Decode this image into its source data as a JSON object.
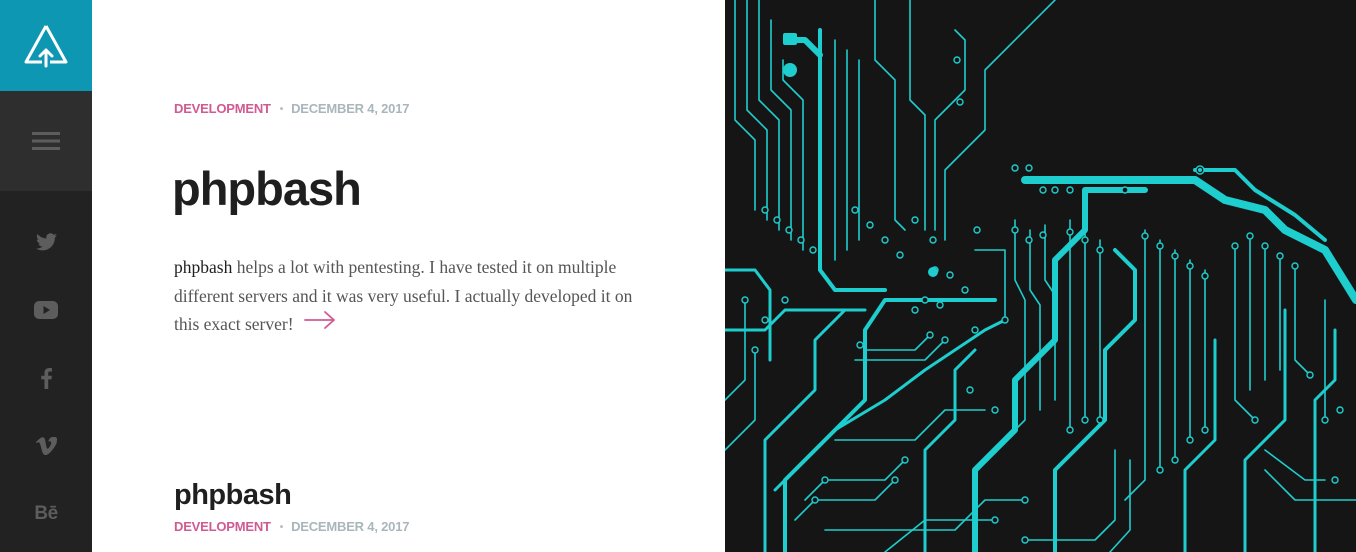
{
  "brand": {
    "logo_icon": "tree-arrow-icon",
    "accent": "#0e97b3"
  },
  "sidebar": {
    "menu_icon": "hamburger-menu-icon",
    "social": [
      {
        "name": "twitter-icon"
      },
      {
        "name": "youtube-icon"
      },
      {
        "name": "facebook-icon"
      },
      {
        "name": "vimeo-icon"
      },
      {
        "name": "behance-icon",
        "label": "Bē"
      }
    ]
  },
  "posts": [
    {
      "category": "DEVELOPMENT",
      "date": "DECEMBER 4, 2017",
      "title": "phpbash",
      "excerpt_lead": "phpbash",
      "excerpt_rest": " helps a lot with pentesting. I have tested it on multiple different servers and it was very useful. I actually developed it on this exact server!",
      "read_more_icon": "arrow-right-icon"
    },
    {
      "title": "phpbash",
      "category": "DEVELOPMENT",
      "date": "DECEMBER 4, 2017"
    }
  ],
  "colors": {
    "category": "#d05a91",
    "date": "#a9b6bb",
    "circuit": "#1ecdcd",
    "hero_bg": "#151515"
  }
}
